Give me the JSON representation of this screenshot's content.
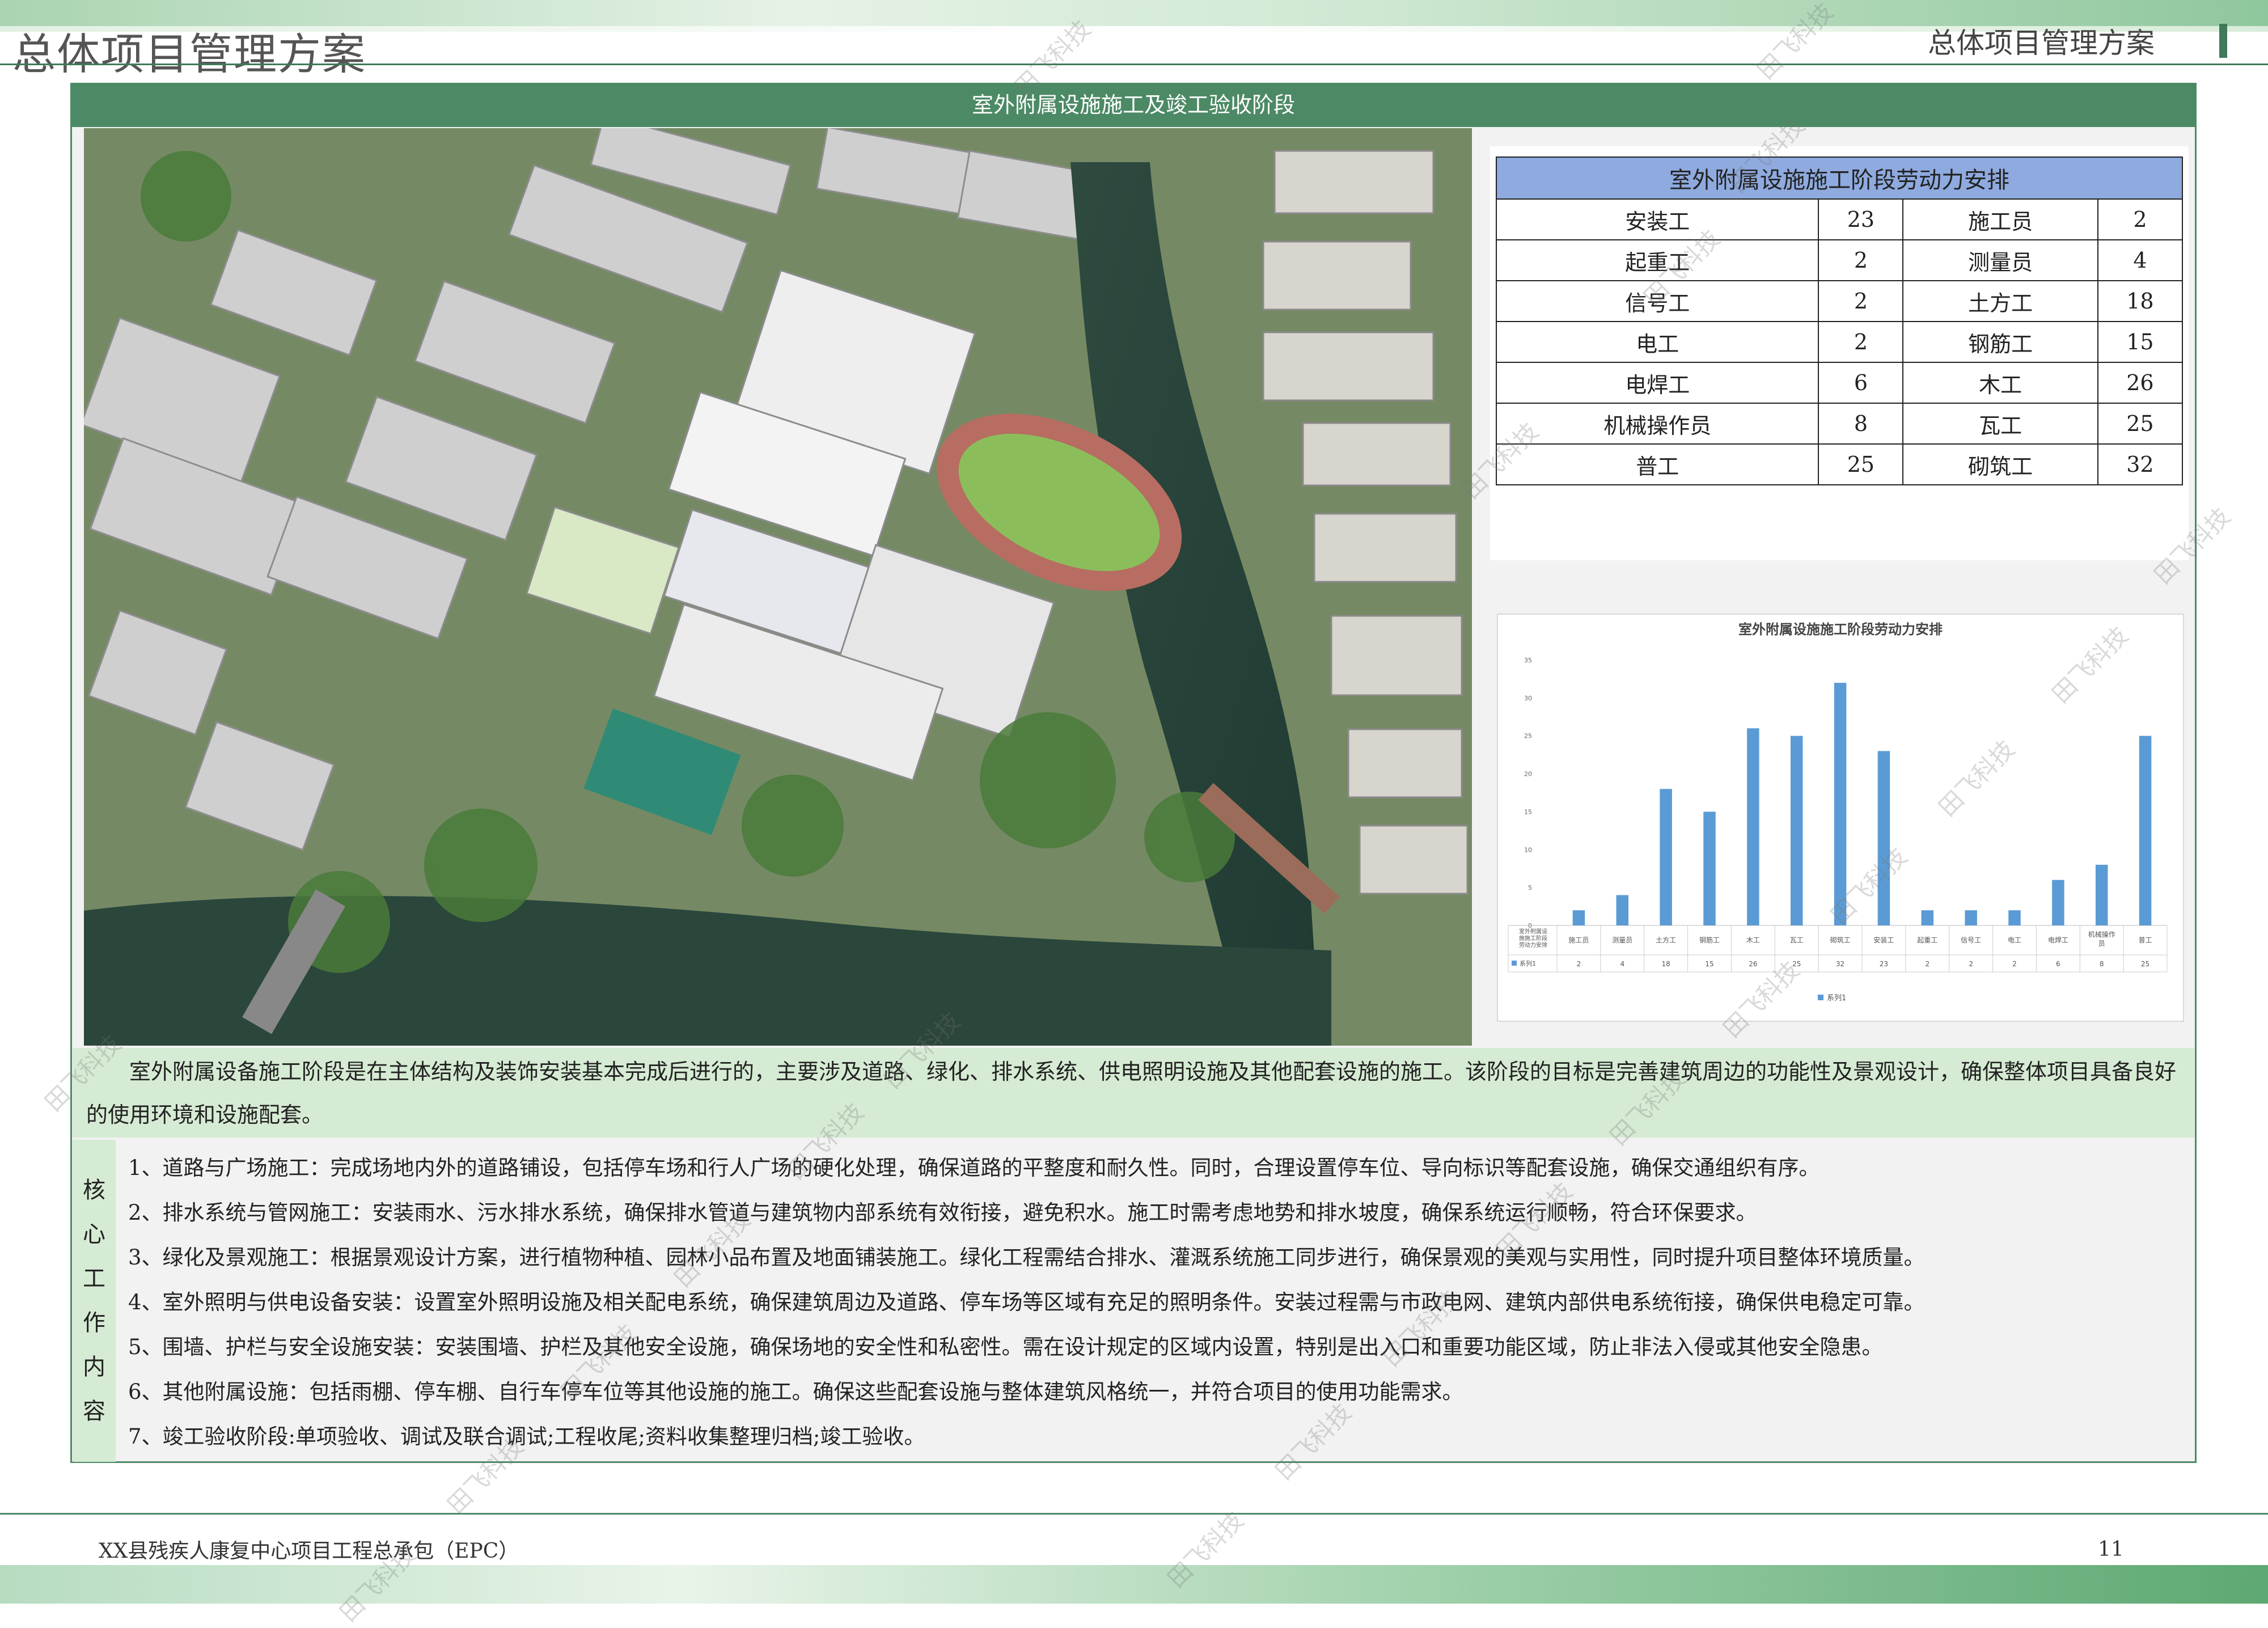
{
  "header": {
    "title_left": "总体项目管理方案",
    "title_right": "总体项目管理方案"
  },
  "section": {
    "title": "室外附属设施施工及竣工验收阶段"
  },
  "labor_table": {
    "title": "室外附属设施施工阶段劳动力安排",
    "rows": [
      [
        "安装工",
        "23",
        "施工员",
        "2"
      ],
      [
        "起重工",
        "2",
        "测量员",
        "4"
      ],
      [
        "信号工",
        "2",
        "土方工",
        "18"
      ],
      [
        "电工",
        "2",
        "钢筋工",
        "15"
      ],
      [
        "电焊工",
        "6",
        "木工",
        "26"
      ],
      [
        "机械操作员",
        "8",
        "瓦工",
        "25"
      ],
      [
        "普工",
        "25",
        "砌筑工",
        "32"
      ]
    ]
  },
  "chart_data": {
    "type": "bar",
    "title": "室外附属设施施工阶段劳动力安排",
    "corner_label": "室外附属设施施工阶段劳动力安排",
    "categories": [
      "施工员",
      "测量员",
      "土方工",
      "钢筋工",
      "木工",
      "瓦工",
      "砌筑工",
      "安装工",
      "起重工",
      "信号工",
      "电工",
      "电焊工",
      "机械操作员",
      "普工"
    ],
    "series": [
      {
        "name": "系列1",
        "values": [
          2,
          4,
          18,
          15,
          26,
          25,
          32,
          23,
          2,
          2,
          2,
          6,
          8,
          25
        ]
      }
    ],
    "ylim": [
      0,
      35
    ],
    "yticks": [
      0,
      5,
      10,
      15,
      20,
      25,
      30,
      35
    ],
    "grid": false,
    "data_table": true,
    "legend": "bottom",
    "bar_color": "#5b9bd5"
  },
  "intro": "室外附属设备施工阶段是在主体结构及装饰安装基本完成后进行的，主要涉及道路、绿化、排水系统、供电照明设施及其他配套设施的施工。该阶段的目标是完善建筑周边的功能性及景观设计，确保整体项目具备良好的使用环境和设施配套。",
  "core": {
    "label": [
      "核",
      "心",
      "工",
      "作",
      "内",
      "容"
    ],
    "items": [
      "1、道路与广场施工：完成场地内外的道路铺设，包括停车场和行人广场的硬化处理，确保道路的平整度和耐久性。同时，合理设置停车位、导向标识等配套设施，确保交通组织有序。",
      "2、排水系统与管网施工：安装雨水、污水排水系统，确保排水管道与建筑物内部系统有效衔接，避免积水。施工时需考虑地势和排水坡度，确保系统运行顺畅，符合环保要求。",
      "3、绿化及景观施工：根据景观设计方案，进行植物种植、园林小品布置及地面铺装施工。绿化工程需结合排水、灌溉系统施工同步进行，确保景观的美观与实用性，同时提升项目整体环境质量。",
      "4、室外照明与供电设备安装：设置室外照明设施及相关配电系统，确保建筑周边及道路、停车场等区域有充足的照明条件。安装过程需与市政电网、建筑内部供电系统衔接，确保供电稳定可靠。",
      "5、围墙、护栏与安全设施安装：安装围墙、护栏及其他安全设施，确保场地的安全性和私密性。需在设计规定的区域内设置，特别是出入口和重要功能区域，防止非法入侵或其他安全隐患。",
      "6、其他附属设施：包括雨棚、停车棚、自行车停车位等其他设施的施工。确保这些配套设施与整体建筑风格统一，并符合项目的使用功能需求。",
      "7、竣工验收阶段:单项验收、调试及联合调试;工程收尾;资料收集整理归档;竣工验收。"
    ]
  },
  "footer": {
    "project": "XX县残疾人康复中心项目工程总承包（EPC）",
    "page_number": "11"
  },
  "watermark": "田飞科技"
}
